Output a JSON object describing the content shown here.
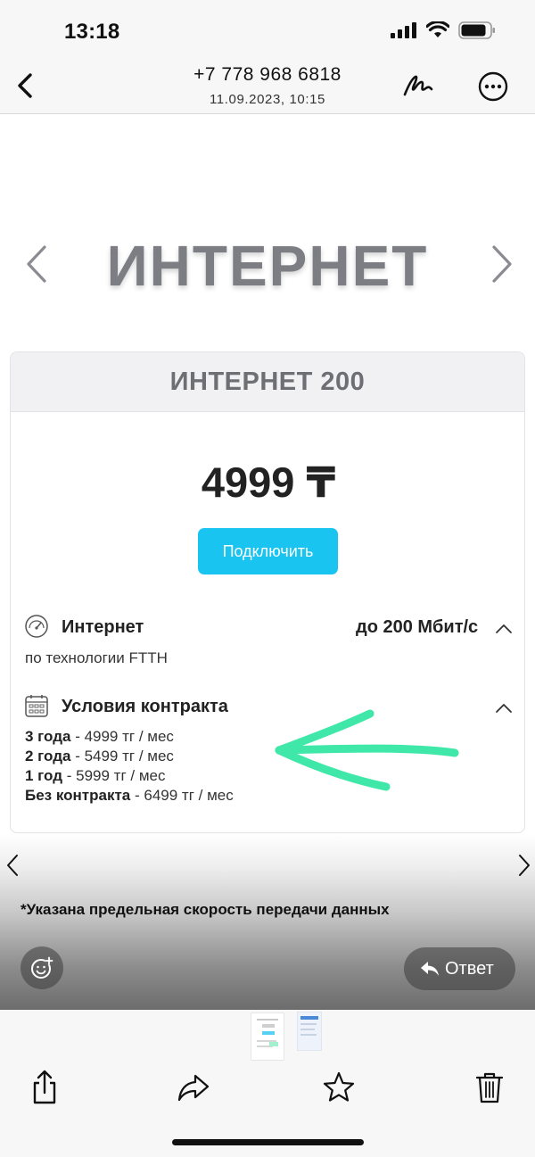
{
  "status": {
    "time": "13:18"
  },
  "nav": {
    "title": "+7 778 968 6818",
    "subtitle": "11.09.2023, 10:15"
  },
  "content": {
    "hero_title": "ИНТЕРНЕТ",
    "card": {
      "header": "ИНТЕРНЕТ 200",
      "price": "4999 ₸",
      "button": "Подключить",
      "internet": {
        "title": "Интернет",
        "speed": "до 200 Мбит/с",
        "subtitle": "по технологии FTTH"
      },
      "contract": {
        "title": "Условия контракта",
        "terms": [
          {
            "term": "3 года",
            "price": "- 4999 тг / мес"
          },
          {
            "term": "2 года",
            "price": "- 5499 тг / мес"
          },
          {
            "term": "1 год",
            "price": "- 5999 тг / мес"
          },
          {
            "term": "Без контракта",
            "price": "- 6499 тг / мес"
          }
        ]
      }
    },
    "footnote": "*Указана предельная скорость передачи данных"
  },
  "actions": {
    "reply": "Ответ"
  },
  "icons": {
    "back": "chevron-left-icon",
    "markup": "markup-pen-icon",
    "more": "ellipsis-circle-icon",
    "emoji": "smiley-add-icon",
    "reply": "reply-arrow-icon",
    "share": "share-icon",
    "forward": "forward-icon",
    "favorite": "star-icon",
    "delete": "trash-icon"
  },
  "colors": {
    "accent_button": "#19c4f0",
    "annotation_arrow": "#3fe8a8"
  }
}
